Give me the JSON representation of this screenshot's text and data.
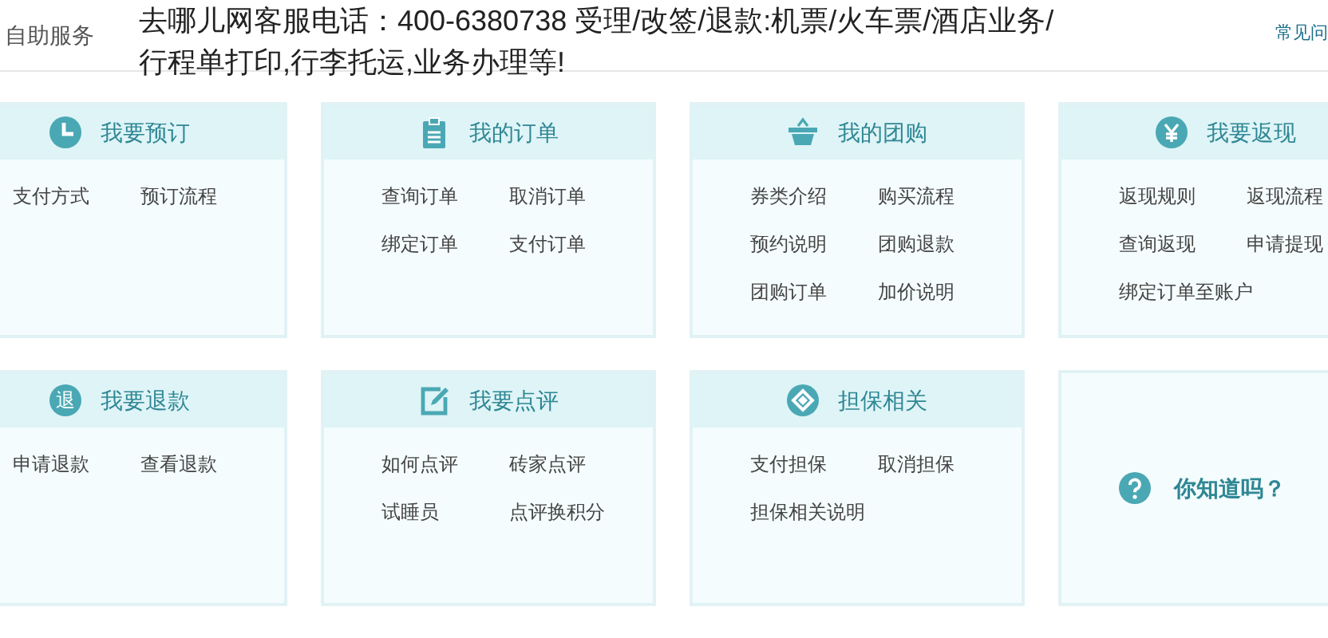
{
  "header": {
    "label": "自助服务",
    "notice": [
      "去哪儿网客服电话：400-6380738 受理/改签/退款:机票/火车票/酒店业务/",
      "行程单打印,行李托运,业务办理等!"
    ],
    "faq_link": "常见问"
  },
  "cards": [
    {
      "kind": "links",
      "title": "我要预订",
      "links": [
        "支付方式",
        "预订流程"
      ]
    },
    {
      "kind": "links",
      "title": "我的订单",
      "links": [
        "查询订单",
        "取消订单",
        "绑定订单",
        "支付订单"
      ]
    },
    {
      "kind": "links",
      "title": "我的团购",
      "links": [
        "券类介绍",
        "购买流程",
        "预约说明",
        "团购退款",
        "团购订单",
        "加价说明"
      ]
    },
    {
      "kind": "links",
      "title": "我要返现",
      "links": [
        "返现规则",
        "返现流程",
        "查询返现",
        "申请提现",
        "绑定订单至账户"
      ]
    },
    {
      "kind": "links",
      "icon_text": "退",
      "title": "我要退款",
      "links": [
        "申请退款",
        "查看退款"
      ]
    },
    {
      "kind": "links",
      "title": "我要点评",
      "links": [
        "如何点评",
        "砖家点评",
        "试睡员",
        "点评换积分"
      ]
    },
    {
      "kind": "links",
      "title": "担保相关",
      "links": [
        "支付担保",
        "取消担保",
        "担保相关说明"
      ]
    },
    {
      "kind": "tip",
      "title": "你知道吗？"
    }
  ]
}
